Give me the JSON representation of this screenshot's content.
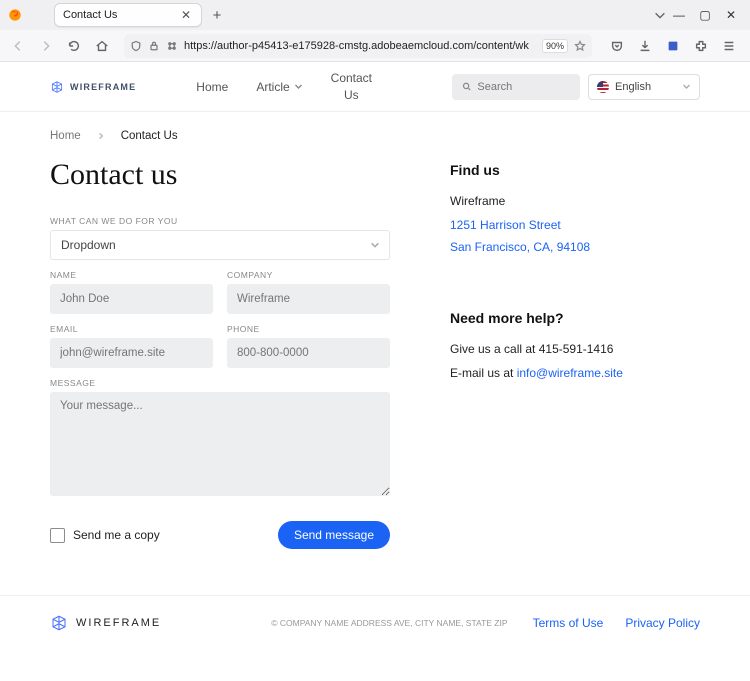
{
  "browser": {
    "tab_title": "Contact Us",
    "url_display": "https://author-p45413-e175928-cmstg.adobeaemcloud.com/content/wk",
    "zoom": "90%"
  },
  "header": {
    "brand": "WIREFRAME",
    "nav": {
      "home": "Home",
      "article": "Article",
      "contact": "Contact Us"
    },
    "search_placeholder": "Search",
    "language": "English"
  },
  "breadcrumb": {
    "home": "Home",
    "current": "Contact Us"
  },
  "page": {
    "title": "Contact us",
    "labels": {
      "what": "WHAT CAN WE DO FOR YOU",
      "name": "NAME",
      "company": "COMPANY",
      "email": "EMAIL",
      "phone": "PHONE",
      "message": "MESSAGE"
    },
    "dropdown_value": "Dropdown",
    "placeholders": {
      "name": "John Doe",
      "company": "Wireframe",
      "email": "john@wireframe.site",
      "phone": "800-800-0000",
      "message": "Your message..."
    },
    "copy_checkbox": "Send me a copy",
    "submit": "Send message"
  },
  "sidebar": {
    "find_title": "Find us",
    "company": "Wireframe",
    "addr1": "1251 Harrison Street",
    "addr2": "San Francisco, CA, 94108",
    "help_title": "Need more help?",
    "call_prefix": "Give us a call at ",
    "phone": "415-591-1416",
    "email_prefix": "E-mail us at ",
    "email": "info@wireframe.site"
  },
  "footer": {
    "brand": "WIREFRAME",
    "copyright": "© COMPANY NAME ADDRESS AVE, CITY NAME, STATE ZIP",
    "terms": "Terms of Use",
    "privacy": "Privacy Policy"
  }
}
